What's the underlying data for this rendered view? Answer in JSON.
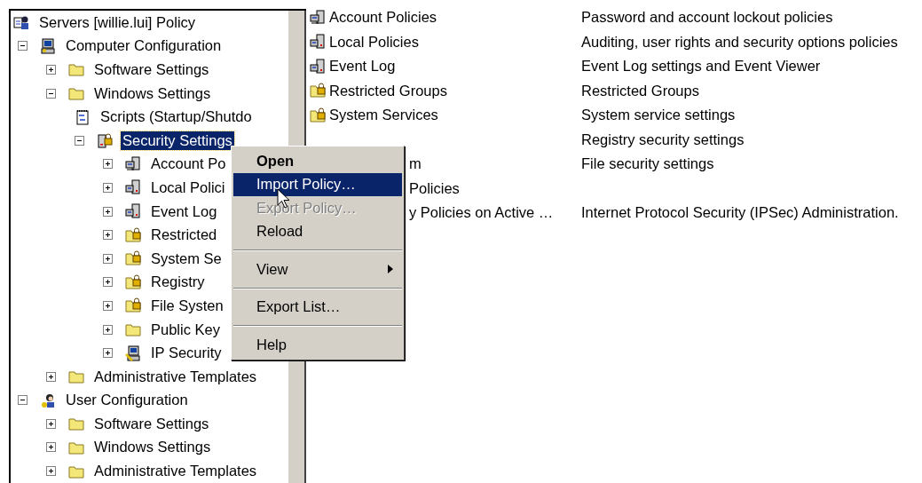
{
  "tree": {
    "label": "Servers [willie.lui] Policy",
    "kind": "policy",
    "children": [
      {
        "label": "Computer Configuration",
        "kind": "computer",
        "expanded": true,
        "children": [
          {
            "label": "Software Settings",
            "kind": "folder",
            "expanded": false
          },
          {
            "label": "Windows Settings",
            "kind": "folder",
            "expanded": true,
            "children": [
              {
                "label": "Scripts (Startup/Shutdo",
                "kind": "script"
              },
              {
                "label": "Security Settings",
                "kind": "security",
                "expanded": true,
                "selected": true,
                "children": [
                  {
                    "label": "Account Po",
                    "kind": "server-net",
                    "expanded": false
                  },
                  {
                    "label": "Local Polici",
                    "kind": "server",
                    "expanded": false
                  },
                  {
                    "label": "Event Log",
                    "kind": "server",
                    "expanded": false
                  },
                  {
                    "label": "Restricted",
                    "kind": "folder-lock",
                    "expanded": false
                  },
                  {
                    "label": "System Se",
                    "kind": "folder-lock",
                    "expanded": false
                  },
                  {
                    "label": "Registry",
                    "kind": "folder-lock",
                    "expanded": false
                  },
                  {
                    "label": "File Systen",
                    "kind": "folder-lock",
                    "expanded": false
                  },
                  {
                    "label": "Public Key",
                    "kind": "folder",
                    "expanded": false
                  },
                  {
                    "label": "IP Security",
                    "kind": "computer-key",
                    "expanded": false
                  }
                ]
              }
            ]
          },
          {
            "label": "Administrative Templates",
            "kind": "folder",
            "expanded": false
          }
        ]
      },
      {
        "label": "User Configuration",
        "kind": "user",
        "expanded": true,
        "children": [
          {
            "label": "Software Settings",
            "kind": "folder",
            "expanded": false
          },
          {
            "label": "Windows Settings",
            "kind": "folder",
            "expanded": false
          },
          {
            "label": "Administrative Templates",
            "kind": "folder",
            "expanded": false
          }
        ]
      }
    ]
  },
  "list": [
    {
      "kind": "server-net",
      "name": "Account Policies",
      "description": "Password and account lockout policies"
    },
    {
      "kind": "server",
      "name": "Local Policies",
      "description": "Auditing, user rights and security options policies"
    },
    {
      "kind": "server",
      "name": "Event Log",
      "description": "Event Log settings and Event Viewer"
    },
    {
      "kind": "folder-lock",
      "name": "Restricted Groups",
      "description": "Restricted Groups"
    },
    {
      "kind": "folder-lock",
      "name": "System Services",
      "description": "System service settings"
    },
    {
      "kind": "covered",
      "description": "Registry security settings"
    },
    {
      "kind": "partial",
      "name": "m",
      "description": "File security settings"
    },
    {
      "kind": "partial",
      "name": "Policies"
    },
    {
      "kind": "partial",
      "name": "y Policies on Active …",
      "description": "Internet Protocol Security (IPSec) Administration."
    }
  ],
  "menu": [
    {
      "kind": "item",
      "label": "Open",
      "default": true,
      "selected": false,
      "disabled": false
    },
    {
      "kind": "item",
      "label": "Import Policy…",
      "default": false,
      "selected": true,
      "disabled": false
    },
    {
      "kind": "item",
      "label": "Export Policy…",
      "default": false,
      "selected": false,
      "disabled": true
    },
    {
      "kind": "item",
      "label": "Reload",
      "default": false,
      "selected": false,
      "disabled": false
    },
    {
      "kind": "separator"
    },
    {
      "kind": "submenu",
      "label": "View",
      "default": false,
      "selected": false,
      "disabled": false
    },
    {
      "kind": "separator"
    },
    {
      "kind": "item",
      "label": "Export List…",
      "default": false,
      "selected": false,
      "disabled": false
    },
    {
      "kind": "separator"
    },
    {
      "kind": "item",
      "label": "Help",
      "default": false,
      "selected": false,
      "disabled": false
    }
  ]
}
